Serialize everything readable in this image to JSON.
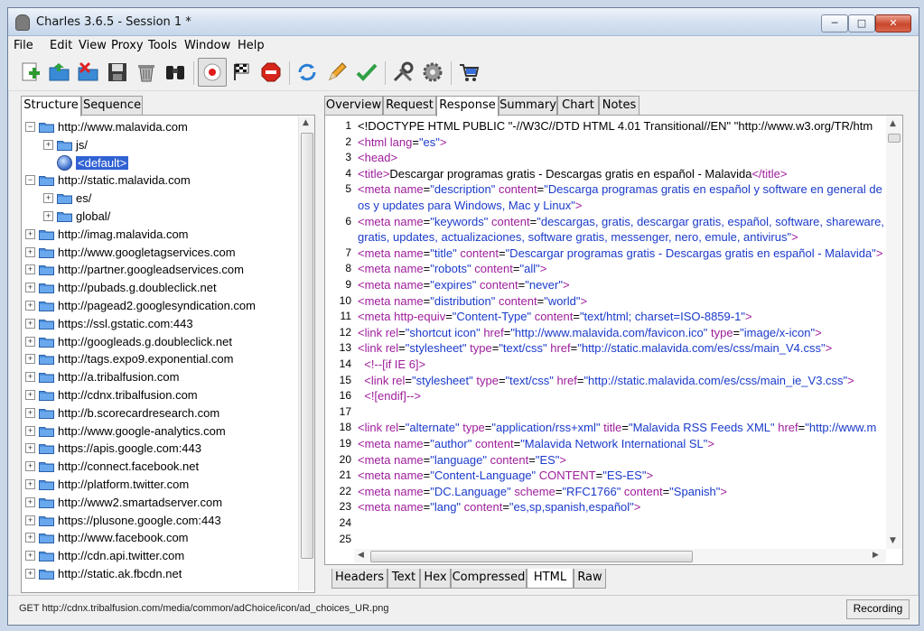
{
  "window": {
    "title": "Charles 3.6.5 - Session 1 *",
    "minimize": "─",
    "maximize": "□",
    "close": "✕"
  },
  "menu": [
    "File",
    "Edit",
    "View",
    "Proxy",
    "Tools",
    "Window",
    "Help"
  ],
  "toolbar_icons": [
    "new-session-icon",
    "open-icon",
    "close-session-icon",
    "save-icon",
    "clear-icon",
    "find-icon",
    "record-icon",
    "throttle-icon",
    "stop-icon",
    "repeat-icon",
    "edit-icon",
    "validate-icon",
    "tools-icon",
    "settings-icon",
    "shop-icon"
  ],
  "left_tabs": [
    "Structure",
    "Sequence"
  ],
  "tree": [
    {
      "label": "http://www.malavida.com",
      "level": 0,
      "kind": "folder",
      "expanded": true
    },
    {
      "label": "js/",
      "level": 1,
      "kind": "folder",
      "expanded": false
    },
    {
      "label": "<default>",
      "level": 1,
      "kind": "globe",
      "selected": true
    },
    {
      "label": "http://static.malavida.com",
      "level": 0,
      "kind": "folder",
      "expanded": true
    },
    {
      "label": "es/",
      "level": 1,
      "kind": "folder",
      "expanded": false
    },
    {
      "label": "global/",
      "level": 1,
      "kind": "folder",
      "expanded": false
    },
    {
      "label": "http://imag.malavida.com",
      "level": 0,
      "kind": "folder"
    },
    {
      "label": "http://www.googletagservices.com",
      "level": 0,
      "kind": "folder"
    },
    {
      "label": "http://partner.googleadservices.com",
      "level": 0,
      "kind": "folder"
    },
    {
      "label": "http://pubads.g.doubleclick.net",
      "level": 0,
      "kind": "folder"
    },
    {
      "label": "http://pagead2.googlesyndication.com",
      "level": 0,
      "kind": "folder"
    },
    {
      "label": "https://ssl.gstatic.com:443",
      "level": 0,
      "kind": "folder"
    },
    {
      "label": "http://googleads.g.doubleclick.net",
      "level": 0,
      "kind": "folder"
    },
    {
      "label": "http://tags.expo9.exponential.com",
      "level": 0,
      "kind": "folder"
    },
    {
      "label": "http://a.tribalfusion.com",
      "level": 0,
      "kind": "folder"
    },
    {
      "label": "http://cdnx.tribalfusion.com",
      "level": 0,
      "kind": "folder"
    },
    {
      "label": "http://b.scorecardresearch.com",
      "level": 0,
      "kind": "folder"
    },
    {
      "label": "http://www.google-analytics.com",
      "level": 0,
      "kind": "folder"
    },
    {
      "label": "https://apis.google.com:443",
      "level": 0,
      "kind": "folder"
    },
    {
      "label": "http://connect.facebook.net",
      "level": 0,
      "kind": "folder"
    },
    {
      "label": "http://platform.twitter.com",
      "level": 0,
      "kind": "folder"
    },
    {
      "label": "http://www2.smartadserver.com",
      "level": 0,
      "kind": "folder"
    },
    {
      "label": "https://plusone.google.com:443",
      "level": 0,
      "kind": "folder"
    },
    {
      "label": "http://www.facebook.com",
      "level": 0,
      "kind": "folder"
    },
    {
      "label": "http://cdn.api.twitter.com",
      "level": 0,
      "kind": "folder"
    },
    {
      "label": "http://static.ak.fbcdn.net",
      "level": 0,
      "kind": "folder"
    }
  ],
  "right_tabs": [
    "Overview",
    "Request",
    "Response",
    "Summary",
    "Chart",
    "Notes"
  ],
  "right_active": "Response",
  "code_lines": [
    {
      "n": "1",
      "parts": [
        [
          "p",
          "<!DOCTYPE HTML PUBLIC \"-//W3C//DTD HTML 4.01 Transitional//EN\" \"http://www.w3.org/TR/htm"
        ]
      ]
    },
    {
      "n": "2",
      "parts": [
        [
          "t",
          "<html "
        ],
        [
          "a",
          "lang"
        ],
        [
          "p",
          "="
        ],
        [
          "v",
          "\"es\""
        ],
        [
          "t",
          ">"
        ]
      ]
    },
    {
      "n": "3",
      "parts": [
        [
          "t",
          "<head>"
        ]
      ]
    },
    {
      "n": "4",
      "parts": [
        [
          "t",
          "<title>"
        ],
        [
          "p",
          "Descargar programas gratis - Descargas gratis en español - Malavida"
        ],
        [
          "t",
          "</title>"
        ]
      ]
    },
    {
      "n": "5",
      "parts": [
        [
          "t",
          "<meta "
        ],
        [
          "a",
          "name"
        ],
        [
          "p",
          "="
        ],
        [
          "v",
          "\"description\""
        ],
        [
          "a",
          " content"
        ],
        [
          "p",
          "="
        ],
        [
          "v",
          "\"Descarga programas gratis en español y software en general de"
        ]
      ]
    },
    {
      "n": "",
      "parts": [
        [
          "v",
          "os y updates para Windows, Mac y Linux\""
        ],
        [
          "t",
          ">"
        ]
      ]
    },
    {
      "n": "6",
      "parts": [
        [
          "t",
          "<meta "
        ],
        [
          "a",
          "name"
        ],
        [
          "p",
          "="
        ],
        [
          "v",
          "\"keywords\""
        ],
        [
          "a",
          " content"
        ],
        [
          "p",
          "="
        ],
        [
          "v",
          "\"descargas, gratis, descargar gratis, español, software, shareware,"
        ]
      ]
    },
    {
      "n": "",
      "parts": [
        [
          "v",
          "gratis, updates, actualizaciones, software gratis, messenger, nero, emule, antivirus\""
        ],
        [
          "t",
          ">"
        ]
      ]
    },
    {
      "n": "7",
      "parts": [
        [
          "t",
          "<meta "
        ],
        [
          "a",
          "name"
        ],
        [
          "p",
          "="
        ],
        [
          "v",
          "\"title\""
        ],
        [
          "a",
          " content"
        ],
        [
          "p",
          "="
        ],
        [
          "v",
          "\"Descargar programas gratis - Descargas gratis en español - Malavida\""
        ],
        [
          "t",
          ">"
        ]
      ]
    },
    {
      "n": "8",
      "parts": [
        [
          "t",
          "<meta "
        ],
        [
          "a",
          "name"
        ],
        [
          "p",
          "="
        ],
        [
          "v",
          "\"robots\""
        ],
        [
          "a",
          " content"
        ],
        [
          "p",
          "="
        ],
        [
          "v",
          "\"all\""
        ],
        [
          "t",
          ">"
        ]
      ]
    },
    {
      "n": "9",
      "parts": [
        [
          "t",
          "<meta "
        ],
        [
          "a",
          "name"
        ],
        [
          "p",
          "="
        ],
        [
          "v",
          "\"expires\""
        ],
        [
          "a",
          " content"
        ],
        [
          "p",
          "="
        ],
        [
          "v",
          "\"never\""
        ],
        [
          "t",
          ">"
        ]
      ]
    },
    {
      "n": "10",
      "parts": [
        [
          "t",
          "<meta "
        ],
        [
          "a",
          "name"
        ],
        [
          "p",
          "="
        ],
        [
          "v",
          "\"distribution\""
        ],
        [
          "a",
          " content"
        ],
        [
          "p",
          "="
        ],
        [
          "v",
          "\"world\""
        ],
        [
          "t",
          ">"
        ]
      ]
    },
    {
      "n": "11",
      "parts": [
        [
          "t",
          "<meta "
        ],
        [
          "a",
          "http-equiv"
        ],
        [
          "p",
          "="
        ],
        [
          "v",
          "\"Content-Type\""
        ],
        [
          "a",
          " content"
        ],
        [
          "p",
          "="
        ],
        [
          "v",
          "\"text/html; charset=ISO-8859-1\""
        ],
        [
          "t",
          ">"
        ]
      ]
    },
    {
      "n": "12",
      "parts": [
        [
          "t",
          "<link "
        ],
        [
          "a",
          "rel"
        ],
        [
          "p",
          "="
        ],
        [
          "v",
          "\"shortcut icon\""
        ],
        [
          "a",
          " href"
        ],
        [
          "p",
          "="
        ],
        [
          "v",
          "\"http://www.malavida.com/favicon.ico\""
        ],
        [
          "a",
          " type"
        ],
        [
          "p",
          "="
        ],
        [
          "v",
          "\"image/x-icon\""
        ],
        [
          "t",
          ">"
        ]
      ]
    },
    {
      "n": "13",
      "parts": [
        [
          "t",
          "<link "
        ],
        [
          "a",
          "rel"
        ],
        [
          "p",
          "="
        ],
        [
          "v",
          "\"stylesheet\""
        ],
        [
          "a",
          " type"
        ],
        [
          "p",
          "="
        ],
        [
          "v",
          "\"text/css\""
        ],
        [
          "a",
          " href"
        ],
        [
          "p",
          "="
        ],
        [
          "v",
          "\"http://static.malavida.com/es/css/main_V4.css\""
        ],
        [
          "t",
          ">"
        ]
      ]
    },
    {
      "n": "14",
      "parts": [
        [
          "t",
          "  <!--[if IE 6]>"
        ]
      ]
    },
    {
      "n": "15",
      "parts": [
        [
          "t",
          "  <link "
        ],
        [
          "a",
          "rel"
        ],
        [
          "p",
          "="
        ],
        [
          "v",
          "\"stylesheet\""
        ],
        [
          "a",
          " type"
        ],
        [
          "p",
          "="
        ],
        [
          "v",
          "\"text/css\""
        ],
        [
          "a",
          " href"
        ],
        [
          "p",
          "="
        ],
        [
          "v",
          "\"http://static.malavida.com/es/css/main_ie_V3.css\""
        ],
        [
          "t",
          ">"
        ]
      ]
    },
    {
      "n": "16",
      "parts": [
        [
          "t",
          "  <![endif]-->"
        ]
      ]
    },
    {
      "n": "17",
      "parts": []
    },
    {
      "n": "18",
      "parts": [
        [
          "t",
          "<link "
        ],
        [
          "a",
          "rel"
        ],
        [
          "p",
          "="
        ],
        [
          "v",
          "\"alternate\""
        ],
        [
          "a",
          " type"
        ],
        [
          "p",
          "="
        ],
        [
          "v",
          "\"application/rss+xml\""
        ],
        [
          "a",
          " title"
        ],
        [
          "p",
          "="
        ],
        [
          "v",
          "\"Malavida RSS Feeds XML\""
        ],
        [
          "a",
          " href"
        ],
        [
          "p",
          "="
        ],
        [
          "v",
          "\"http://www.m"
        ]
      ]
    },
    {
      "n": "19",
      "parts": [
        [
          "t",
          "<meta "
        ],
        [
          "a",
          "name"
        ],
        [
          "p",
          "="
        ],
        [
          "v",
          "\"author\""
        ],
        [
          "a",
          " content"
        ],
        [
          "p",
          "="
        ],
        [
          "v",
          "\"Malavida Network International SL\""
        ],
        [
          "t",
          ">"
        ]
      ]
    },
    {
      "n": "20",
      "parts": [
        [
          "t",
          "<meta "
        ],
        [
          "a",
          "name"
        ],
        [
          "p",
          "="
        ],
        [
          "v",
          "\"language\""
        ],
        [
          "a",
          " content"
        ],
        [
          "p",
          "="
        ],
        [
          "v",
          "\"ES\""
        ],
        [
          "t",
          ">"
        ]
      ]
    },
    {
      "n": "21",
      "parts": [
        [
          "t",
          "<meta "
        ],
        [
          "a",
          "name"
        ],
        [
          "p",
          "="
        ],
        [
          "v",
          "\"Content-Language\""
        ],
        [
          "a",
          " CONTENT"
        ],
        [
          "p",
          "="
        ],
        [
          "v",
          "\"ES-ES\""
        ],
        [
          "t",
          ">"
        ]
      ]
    },
    {
      "n": "22",
      "parts": [
        [
          "t",
          "<meta "
        ],
        [
          "a",
          "name"
        ],
        [
          "p",
          "="
        ],
        [
          "v",
          "\"DC.Language\""
        ],
        [
          "a",
          " scheme"
        ],
        [
          "p",
          "="
        ],
        [
          "v",
          "\"RFC1766\""
        ],
        [
          "a",
          " content"
        ],
        [
          "p",
          "="
        ],
        [
          "v",
          "\"Spanish\""
        ],
        [
          "t",
          ">"
        ]
      ]
    },
    {
      "n": "23",
      "parts": [
        [
          "t",
          "<meta "
        ],
        [
          "a",
          "name"
        ],
        [
          "p",
          "="
        ],
        [
          "v",
          "\"lang\""
        ],
        [
          "a",
          " content"
        ],
        [
          "p",
          "="
        ],
        [
          "v",
          "\"es,sp,spanish,español\""
        ],
        [
          "t",
          ">"
        ]
      ]
    },
    {
      "n": "24",
      "parts": []
    },
    {
      "n": "25",
      "parts": []
    }
  ],
  "bottom_tabs": [
    "Headers",
    "Text",
    "Hex",
    "Compressed",
    "HTML",
    "Raw"
  ],
  "bottom_active": "HTML",
  "status": {
    "text": "GET http://cdnx.tribalfusion.com/media/common/adChoice/icon/ad_choices_UR.png",
    "recording": "Recording"
  },
  "colors": {
    "tag": "#9e1e9b",
    "value": "#1a3acb",
    "selection": "#3162d3"
  }
}
